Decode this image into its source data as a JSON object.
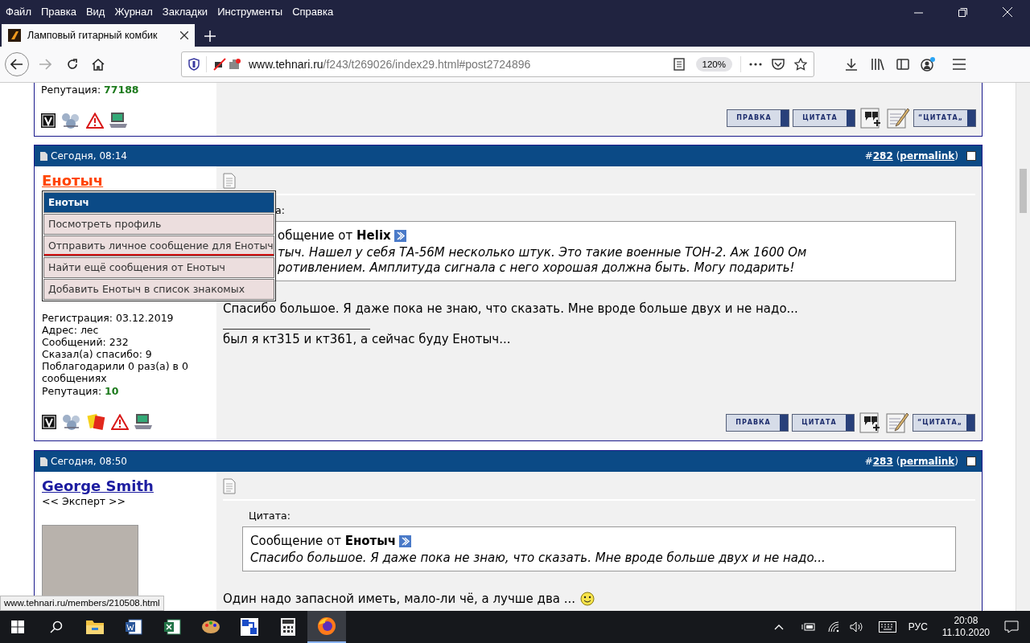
{
  "menu_bar": {
    "items": [
      "Файл",
      "Правка",
      "Вид",
      "Журнал",
      "Закладки",
      "Инструменты",
      "Справка"
    ]
  },
  "tabs": [
    {
      "title": "Ламповый гитарный комбик",
      "selected": true
    }
  ],
  "address_bar": {
    "url_host": "www.tehnari.ru",
    "url_path": "/f243/t269026/index29.html#post2724896",
    "zoom": "120%"
  },
  "posts": [
    {
      "kind": "partial",
      "reputation_label": "Репутация: ",
      "reputation": "77188",
      "user_icons": [
        {
          "kind": "v"
        },
        {
          "kind": "network"
        },
        {
          "kind": "warning"
        },
        {
          "kind": "computer"
        }
      ],
      "actions": [
        {
          "kind": "button",
          "label": "ПРАВКА"
        },
        {
          "kind": "button",
          "label": "ЦИТАТА"
        },
        {
          "kind": "multiquote"
        },
        {
          "kind": "reply"
        },
        {
          "kind": "button",
          "label": "“ЦИТАТА„"
        }
      ]
    },
    {
      "kind": "full",
      "date": "Сегодня, 08:14",
      "number_prefix": "#",
      "number": "282",
      "paren_open": "(",
      "permalink": "permalink",
      "paren_close": ")",
      "checked": false,
      "author": {
        "name": "Енотыч",
        "color": "#ff4500"
      },
      "popup": {
        "title": "Енотыч",
        "items": [
          {
            "label": "Посмотреть профиль",
            "selected": false
          },
          {
            "label": "Отправить личное сообщение для Енотыч",
            "selected": true
          },
          {
            "label": "Найти ещё сообщения от Енотыч",
            "selected": false
          },
          {
            "label": "Добавить Енотыч в список знакомых",
            "selected": false
          }
        ]
      },
      "stats": [
        "Регистрация: 03.12.2019",
        "Адрес: лес",
        "Сообщений: 232",
        "Сказал(а) спасибо: 9",
        "Поблагодарили 0 раз(а) в 0 сообщениях"
      ],
      "reputation_label": "Репутация: ",
      "reputation": "10",
      "user_icons": [
        {
          "kind": "v"
        },
        {
          "kind": "network"
        },
        {
          "kind": "card"
        },
        {
          "kind": "warning"
        },
        {
          "kind": "computer"
        }
      ],
      "quote": {
        "partly_hidden": true,
        "label": "а:",
        "from_prefix": "общение от ",
        "from": "Helix",
        "lines": [
          "тыч. Нашел у себя ТА-56М несколько штук. Это такие военные ТОН-2. Аж 1600 Ом",
          "ротивлением. Амплитуда сигнала с него хорошая должна быть. Могу подарить!"
        ]
      },
      "body": [
        {
          "text": "Спасибо большое. Я даже пока не знаю, что сказать. Мне вроде больше двух и не надо..."
        }
      ],
      "signature_rule": true,
      "signature": "был я кт315 и кт361, а сейчас буду Енотыч...",
      "actions": [
        {
          "kind": "button",
          "label": "ПРАВКА"
        },
        {
          "kind": "button",
          "label": "ЦИТАТА"
        },
        {
          "kind": "multiquote"
        },
        {
          "kind": "reply"
        },
        {
          "kind": "button",
          "label": "“ЦИТАТА„"
        }
      ]
    },
    {
      "kind": "full",
      "date": "Сегодня, 08:50",
      "number_prefix": "#",
      "number": "283",
      "paren_open": "(",
      "permalink": "permalink",
      "paren_close": ")",
      "checked": false,
      "author": {
        "name": "George Smith",
        "color": "#1c1ca0"
      },
      "user_title": "<< Эксперт >>",
      "avatar": true,
      "quote": {
        "partly_hidden": false,
        "label": "Цитата:",
        "from_prefix": "Сообщение от ",
        "from": "Енотыч",
        "lines": [
          "Спасибо большое. Я даже пока не знаю, что сказать. Мне вроде больше двух и не надо..."
        ]
      },
      "body": [
        {
          "text": "Один надо запасной иметь, мало-ли чё, а лучше два ...",
          "kind": "smile"
        }
      ]
    }
  ],
  "status_link": "www.tehnari.ru/members/210508.html",
  "taskbar": {
    "apps": [
      {
        "kind": "explorer",
        "selected": false
      },
      {
        "kind": "word",
        "selected": false
      },
      {
        "kind": "excel",
        "selected": false
      },
      {
        "kind": "paint",
        "selected": false
      },
      {
        "kind": "network",
        "selected": false
      },
      {
        "kind": "calculator",
        "selected": false
      },
      {
        "kind": "firefox",
        "selected": true
      }
    ],
    "language": "РУС",
    "time": "20:08",
    "date": "11.10.2020"
  }
}
